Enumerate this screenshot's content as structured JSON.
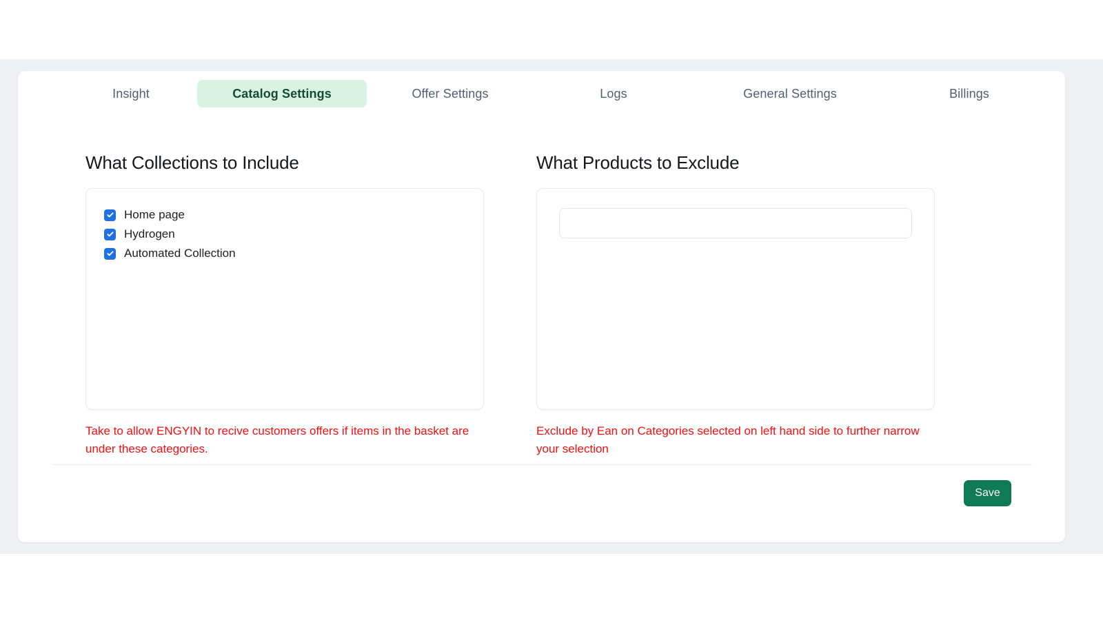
{
  "tabs": [
    {
      "label": "Insight",
      "active": false
    },
    {
      "label": "Catalog Settings",
      "active": true
    },
    {
      "label": "Offer Settings",
      "active": false
    },
    {
      "label": "Logs",
      "active": false
    },
    {
      "label": "General Settings",
      "active": false
    },
    {
      "label": "Billings",
      "active": false
    }
  ],
  "include_section": {
    "heading": "What Collections to Include",
    "collections": [
      {
        "label": "Home page",
        "checked": true
      },
      {
        "label": "Hydrogen",
        "checked": true
      },
      {
        "label": "Automated Collection",
        "checked": true
      }
    ],
    "helper_text": "Take to allow ENGYIN to recive customers offers if items in the basket are under these categories."
  },
  "exclude_section": {
    "heading": "What Products to Exclude",
    "search_value": "",
    "search_placeholder": "",
    "helper_text": "Exclude by Ean on Categories selected on left hand side to further narrow your selection"
  },
  "footer": {
    "save_label": "Save"
  },
  "colors": {
    "active_tab_bg": "#d8f2e3",
    "active_tab_text": "#174b33",
    "inactive_tab_text": "#525f73",
    "checkbox_blue": "#1f6fe5",
    "helper_red": "#fb0d0d",
    "save_green": "#0f7a55",
    "page_band": "#eef0f4",
    "panel_border": "#e8eaee"
  }
}
